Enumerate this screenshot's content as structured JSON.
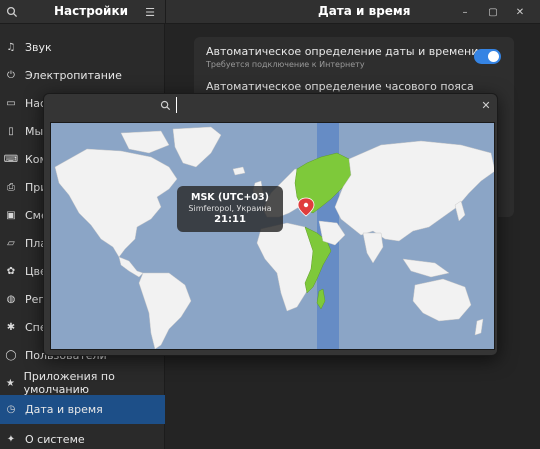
{
  "header": {
    "sidebar_title": "Настройки",
    "main_title": "Дата и время"
  },
  "sidebar": {
    "items": [
      {
        "label": "Звук",
        "icon": "music-note-icon"
      },
      {
        "label": "Электропитание",
        "icon": "power-icon"
      },
      {
        "label": "Наст",
        "icon": "monitor-icon"
      },
      {
        "label": "Мыш",
        "icon": "mouse-icon"
      },
      {
        "label": "Комб",
        "icon": "keyboard-icon"
      },
      {
        "label": "Прин",
        "icon": "printer-icon"
      },
      {
        "label": "Смен",
        "icon": "removable-media-icon"
      },
      {
        "label": "План",
        "icon": "tablet-icon"
      },
      {
        "label": "Цвет",
        "icon": "palette-icon"
      },
      {
        "label": "Реги",
        "icon": "globe-icon"
      },
      {
        "label": "Спец",
        "icon": "accessibility-icon"
      },
      {
        "label": "Пользователи",
        "icon": "user-icon"
      },
      {
        "label": "Приложения по умолчанию",
        "icon": "star-icon"
      },
      {
        "label": "Дата и время",
        "icon": "clock-icon",
        "active": true
      },
      {
        "label": "О системе",
        "icon": "sparkle-icon"
      }
    ]
  },
  "main": {
    "auto_datetime_title": "Автоматическое определение даты и времени",
    "auto_datetime_subtitle": "Требуется подключение к Интернету",
    "auto_datetime_enabled": true,
    "auto_timezone_title": "Автоматическое определение часового пояса"
  },
  "timezone_dialog": {
    "search_value": "",
    "tooltip": {
      "zone": "MSK (UTC+03)",
      "city": "Simferopol, Украина",
      "time": "21:11"
    }
  },
  "colors": {
    "accent": "#3584e4",
    "selected_sidebar": "#1d4f88",
    "ocean": "#8ba5c6",
    "land": "#f2f2f2",
    "highlight_zone": "#7ec93a",
    "timezone_band": "#5f87c4",
    "location_pin": "#e03c3c"
  }
}
